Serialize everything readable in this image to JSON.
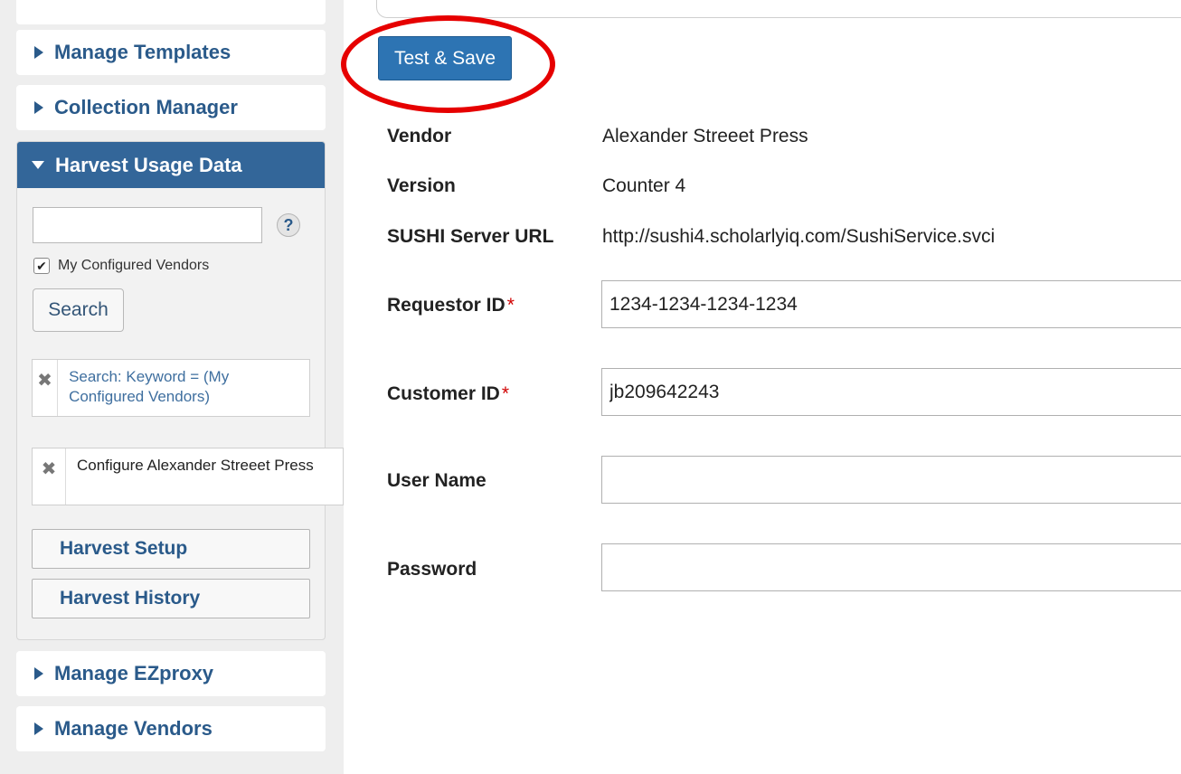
{
  "sidebar": {
    "panels": [
      {
        "label": "Manage Templates"
      },
      {
        "label": "Collection Manager"
      },
      {
        "label": "Harvest Usage Data"
      },
      {
        "label": "Manage EZproxy"
      },
      {
        "label": "Manage Vendors"
      }
    ],
    "harvest": {
      "keyword_value": "",
      "help_symbol": "?",
      "checkbox_label": "My Configured Vendors",
      "checkbox_checked": true,
      "search_label": "Search",
      "filters": [
        {
          "text": "Search: Keyword = (My Configured Vendors)"
        },
        {
          "text": "Configure Alexander Streeet Press"
        }
      ],
      "remove_symbol": "✖",
      "buttons": {
        "setup": "Harvest Setup",
        "history": "Harvest History"
      }
    }
  },
  "main": {
    "test_save_label": "Test & Save",
    "vendor": {
      "label": "Vendor",
      "value": "Alexander Streeet Press"
    },
    "version": {
      "label": "Version",
      "value": "Counter 4"
    },
    "sushi": {
      "label": "SUSHI Server URL",
      "value": "http://sushi4.scholarlyiq.com/SushiService.svci"
    },
    "requestor": {
      "label": "Requestor ID",
      "value": "1234-1234-1234-1234"
    },
    "customer": {
      "label": "Customer ID",
      "value": "jb209642243"
    },
    "username": {
      "label": "User Name",
      "value": ""
    },
    "password": {
      "label": "Password",
      "value": ""
    },
    "required_mark": "*"
  },
  "colors": {
    "panel_active": "#336699",
    "link": "#2a5a8a",
    "primary_button": "#2d74b3",
    "annotation_ring": "#e60000",
    "required": "#d00000"
  }
}
